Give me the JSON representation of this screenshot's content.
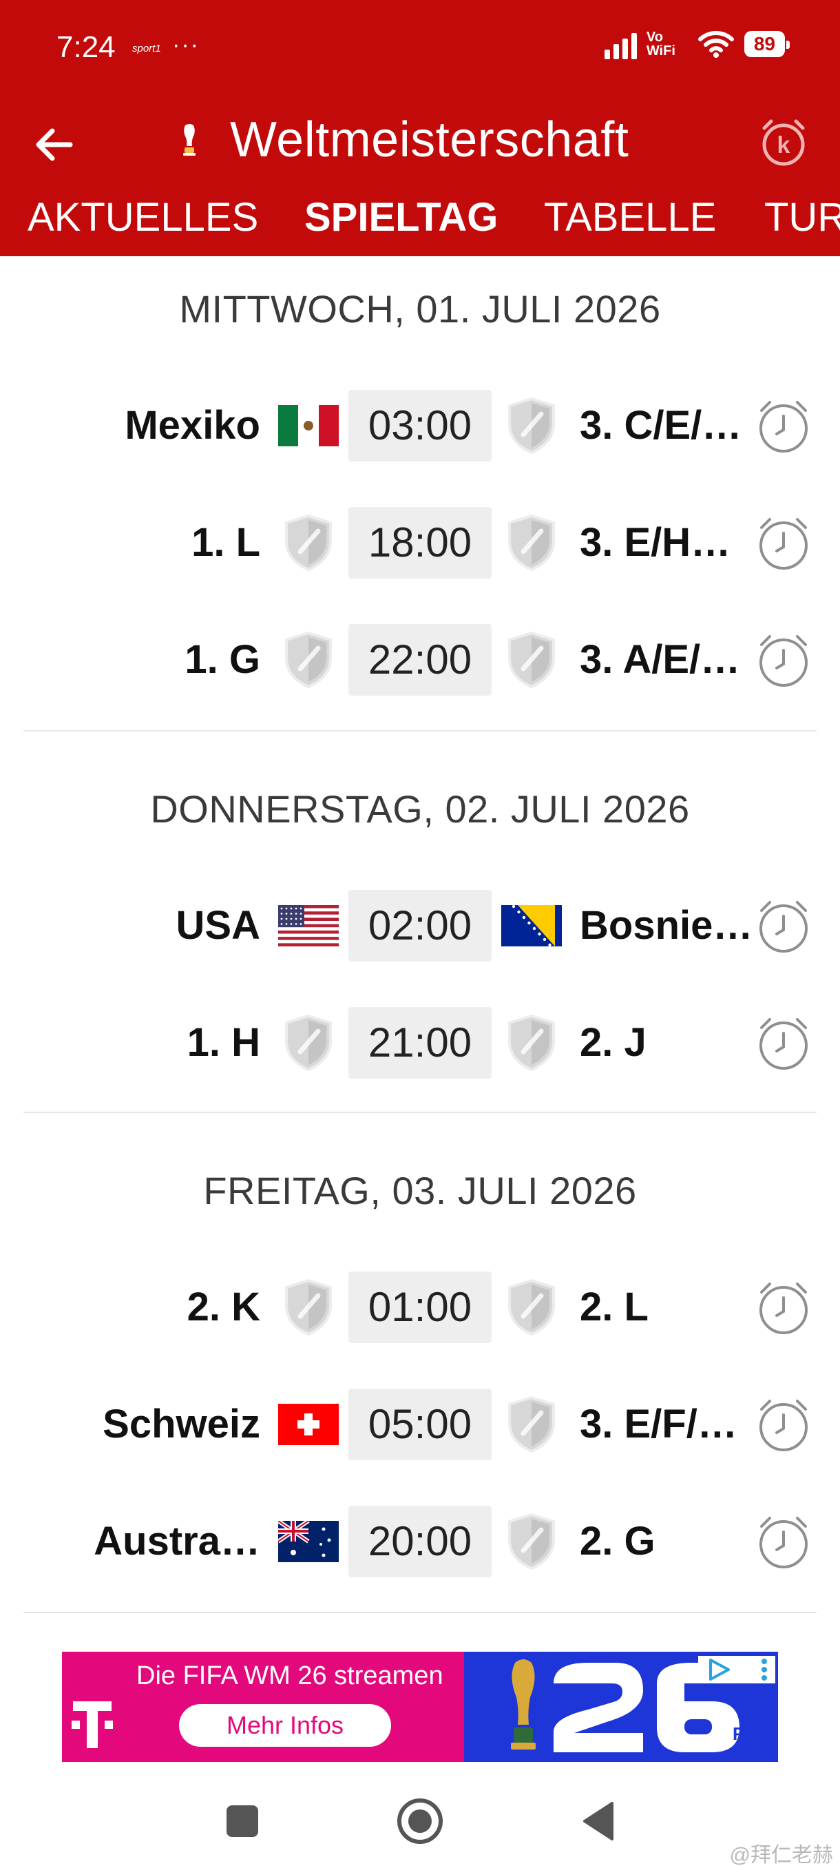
{
  "status": {
    "time": "7:24",
    "notification_tag": "sport1",
    "more_dots": "···",
    "network": "Vo WiFi",
    "battery": "89"
  },
  "header": {
    "title": "Weltmeisterschaft",
    "tabs": [
      {
        "label": "AKTUELLES",
        "active": false
      },
      {
        "label": "SPIELTAG",
        "active": true
      },
      {
        "label": "TABELLE",
        "active": false
      },
      {
        "label": "TUR",
        "active": false
      }
    ]
  },
  "days": [
    {
      "date": "MITTWOCH, 01. JULI 2026",
      "matches": [
        {
          "home": "Mexiko",
          "home_badge": "flag-mexico",
          "time": "03:00",
          "away": "3. C/E/…",
          "away_badge": "placeholder-shield"
        },
        {
          "home": "1. L",
          "home_badge": "placeholder-shield",
          "time": "18:00",
          "away": "3. E/H…",
          "away_badge": "placeholder-shield"
        },
        {
          "home": "1. G",
          "home_badge": "placeholder-shield",
          "time": "22:00",
          "away": "3. A/E/…",
          "away_badge": "placeholder-shield"
        }
      ]
    },
    {
      "date": "DONNERSTAG, 02. JULI 2026",
      "matches": [
        {
          "home": "USA",
          "home_badge": "flag-usa",
          "time": "02:00",
          "away": "Bosnie…",
          "away_badge": "flag-bosnia"
        },
        {
          "home": "1. H",
          "home_badge": "placeholder-shield",
          "time": "21:00",
          "away": "2. J",
          "away_badge": "placeholder-shield"
        }
      ]
    },
    {
      "date": "FREITAG, 03. JULI 2026",
      "matches": [
        {
          "home": "2. K",
          "home_badge": "placeholder-shield",
          "time": "01:00",
          "away": "2. L",
          "away_badge": "placeholder-shield"
        },
        {
          "home": "Schweiz",
          "home_badge": "flag-switzerland",
          "time": "05:00",
          "away": "3. E/F/…",
          "away_badge": "placeholder-shield"
        },
        {
          "home": "Austra…",
          "home_badge": "flag-australia",
          "time": "20:00",
          "away": "2. G",
          "away_badge": "placeholder-shield"
        }
      ]
    }
  ],
  "ad": {
    "headline": "Die FIFA WM 26 streamen",
    "button": "Mehr Infos",
    "brand": "FIFA"
  },
  "watermark": "@拜仁老赫",
  "colors": {
    "brand_red": "#c20a0a",
    "telekom_magenta": "#e3087c",
    "ad_blue": "#1e36d8"
  }
}
